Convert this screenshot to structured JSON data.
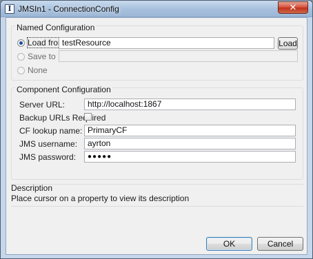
{
  "window": {
    "title": "JMSIn1 - ConnectionConfig",
    "icon_letter": "I",
    "close_glyph": "✕"
  },
  "named_configuration": {
    "title": "Named Configuration",
    "load_from_label": "Load from",
    "load_from_value": "testResource",
    "load_button": "Load",
    "save_to_label": "Save to",
    "save_to_value": "",
    "none_label": "None",
    "selected": "load_from"
  },
  "component_configuration": {
    "title": "Component Configuration",
    "server_url_label": "Server URL:",
    "server_url_value": "http://localhost:1867",
    "backup_urls_label": "Backup URLs Required",
    "backup_urls_checked": false,
    "cf_lookup_label": "CF lookup name:",
    "cf_lookup_value": "PrimaryCF",
    "jms_username_label": "JMS username:",
    "jms_username_value": "ayrton",
    "jms_password_label": "JMS password:",
    "jms_password_value": "●●●●●"
  },
  "description": {
    "title": "Description",
    "text": "Place cursor on a property to view its description"
  },
  "buttons": {
    "ok": "OK",
    "cancel": "Cancel"
  }
}
